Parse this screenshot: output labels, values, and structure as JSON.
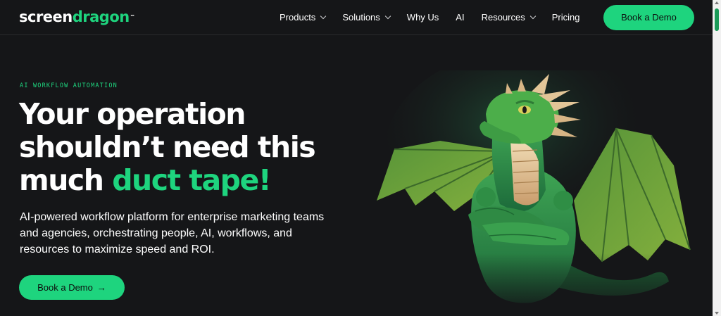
{
  "header": {
    "logo": {
      "part1": "screen",
      "part2": "dragon",
      "tm": "™"
    },
    "nav": [
      {
        "label": "Products",
        "dropdown": true
      },
      {
        "label": "Solutions",
        "dropdown": true
      },
      {
        "label": "Why Us",
        "dropdown": false
      },
      {
        "label": "AI",
        "dropdown": false
      },
      {
        "label": "Resources",
        "dropdown": true
      },
      {
        "label": "Pricing",
        "dropdown": false
      }
    ],
    "cta_label": "Book a Demo"
  },
  "hero": {
    "eyebrow": "AI WORKFLOW AUTOMATION",
    "headline_line1": "Your operation",
    "headline_line2": "shouldn’t need this",
    "headline_line3_plain": "much ",
    "headline_line3_accent": "duct tape!",
    "subtext": "AI-powered workflow platform for enterprise marketing teams and agencies, orchestrating people, AI, workflows, and resources to maximize speed and ROI.",
    "cta_label": "Book a Demo",
    "cta_icon": "arrow-right-icon"
  },
  "colors": {
    "background": "#151618",
    "accent": "#1ed47e",
    "text": "#ffffff"
  }
}
